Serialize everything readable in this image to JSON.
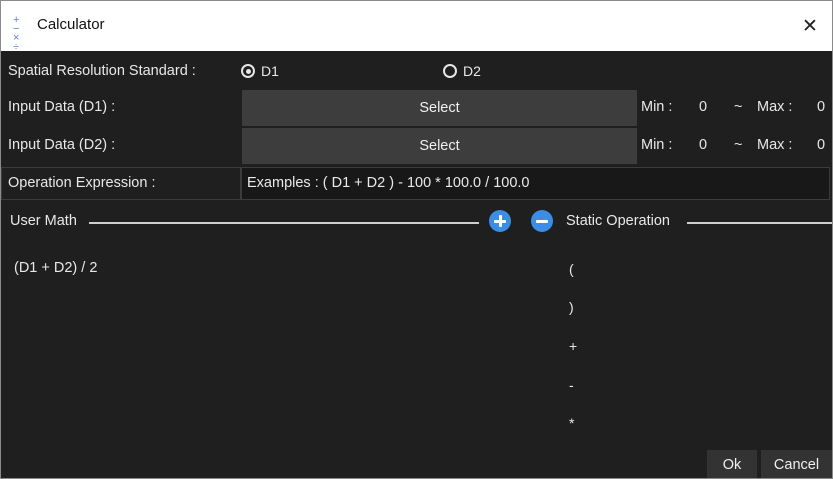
{
  "window": {
    "title": "Calculator",
    "icon": "calculator-icon",
    "close_label": "✕"
  },
  "spatial": {
    "label": "Spatial Resolution Standard :",
    "options": [
      "D1",
      "D2"
    ],
    "selected": "D1"
  },
  "input1": {
    "label": "Input Data (D1) :",
    "button": "Select",
    "min_label": "Min :",
    "min_value": "0",
    "tilde": "~",
    "max_label": "Max :",
    "max_value": "0"
  },
  "input2": {
    "label": "Input Data (D2) :",
    "button": "Select",
    "min_label": "Min :",
    "min_value": "0",
    "tilde": "~",
    "max_label": "Max :",
    "max_value": "0"
  },
  "expression": {
    "label": "Operation Expression :",
    "value": "Examples : ( D1 + D2 ) - 100 * 100.0 / 100.0"
  },
  "user_math": {
    "title": "User Math",
    "items": [
      "(D1 + D2) / 2"
    ]
  },
  "static_operation": {
    "title": "Static Operation",
    "items": [
      "(",
      ")",
      "+",
      "-",
      "*"
    ]
  },
  "buttons": {
    "ok": "Ok",
    "cancel": "Cancel"
  },
  "colors": {
    "accent": "#3b8ee8",
    "background": "#1f1f1f",
    "button": "#3d3d3d"
  }
}
